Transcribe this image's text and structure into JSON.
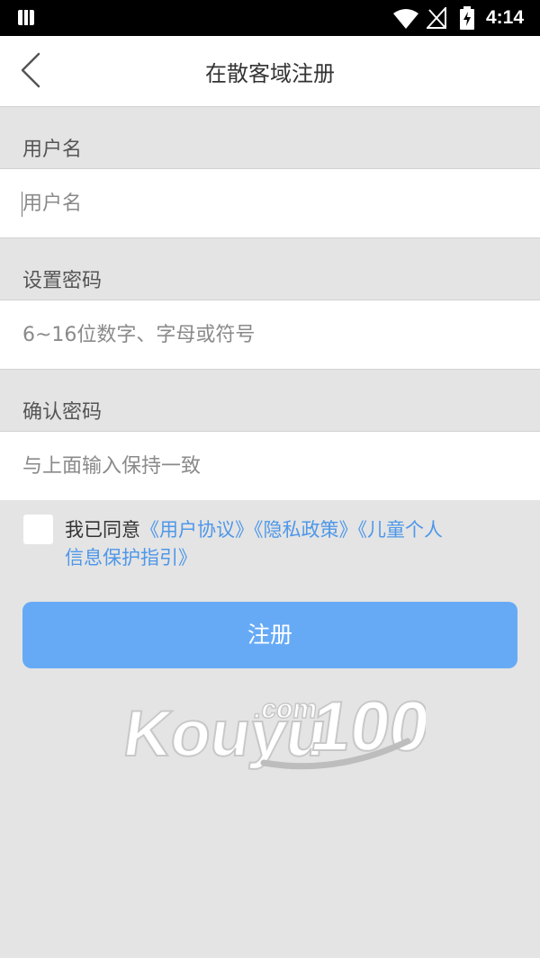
{
  "status_bar": {
    "time": "4:14",
    "icons": [
      "notification-icon",
      "wifi-icon",
      "no-signal-icon",
      "battery-charging-icon"
    ]
  },
  "nav": {
    "title": "在散客域注册",
    "back_icon": "chevron-left-icon"
  },
  "form": {
    "username": {
      "label": "用户名",
      "placeholder": "用户名",
      "value": ""
    },
    "password": {
      "label": "设置密码",
      "placeholder": "6~16位数字、字母或符号",
      "value": ""
    },
    "confirm_password": {
      "label": "确认密码",
      "placeholder": "与上面输入保持一致",
      "value": ""
    }
  },
  "agreement": {
    "checked": false,
    "prefix": "我已同意",
    "links": [
      "《用户协议》",
      "《隐私政策》",
      "《儿童个人"
    ],
    "link_line2": "信息保护指引》"
  },
  "register_button": {
    "label": "注册"
  },
  "watermark": {
    "text": "Kouyu",
    "suffix": ".com",
    "number": "100"
  },
  "colors": {
    "background": "#e4e4e4",
    "link": "#4e97e9",
    "button": "#66aaf6",
    "status_bar": "#000000"
  }
}
